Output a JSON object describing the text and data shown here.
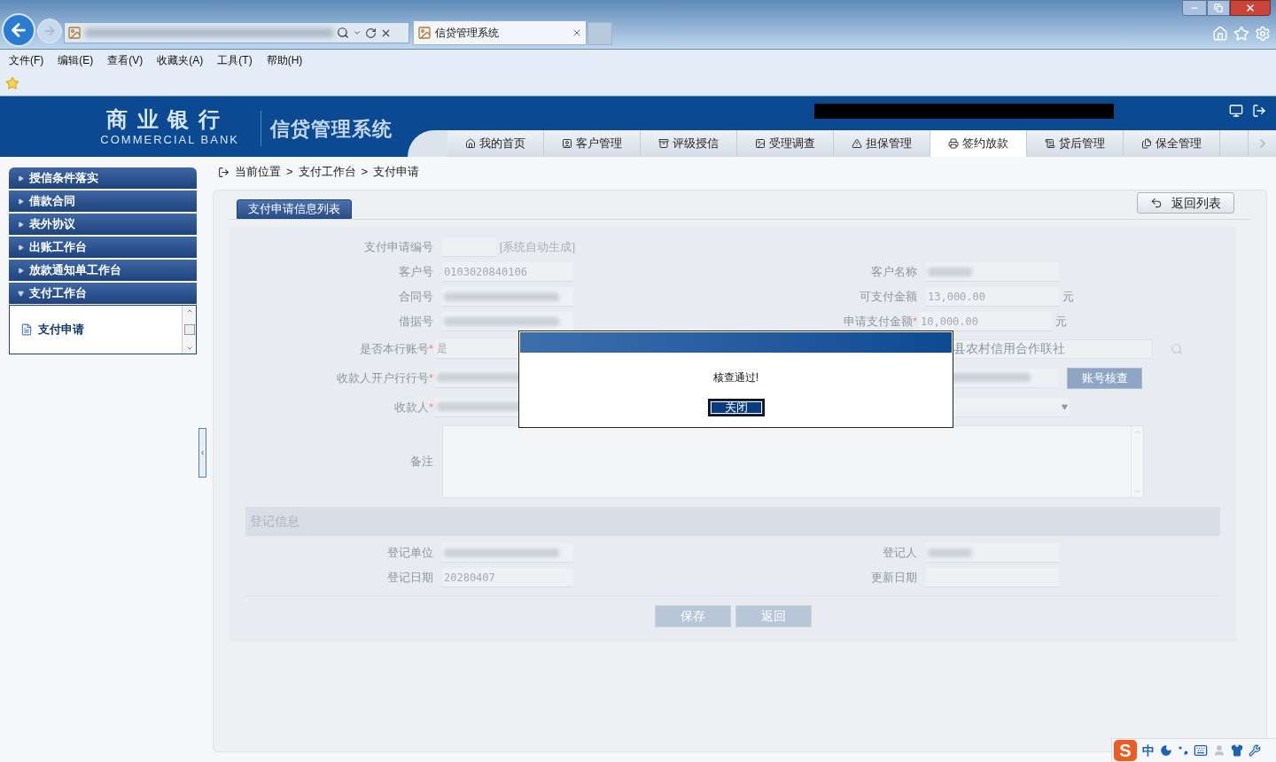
{
  "browser": {
    "tab_title": "信贷管理系统",
    "menu": [
      "文件(F)",
      "编辑(E)",
      "查看(V)",
      "收藏夹(A)",
      "工具(T)",
      "帮助(H)"
    ]
  },
  "header": {
    "logo_cn": "商 业 银 行",
    "logo_en": "COMMERCIAL BANK",
    "system_name": "信贷管理系统"
  },
  "nav": [
    {
      "label": "我的首页",
      "selected": false
    },
    {
      "label": "客户管理",
      "selected": false
    },
    {
      "label": "评级授信",
      "selected": false
    },
    {
      "label": "受理调查",
      "selected": false
    },
    {
      "label": "担保管理",
      "selected": false
    },
    {
      "label": "签约放款",
      "selected": true
    },
    {
      "label": "贷后管理",
      "selected": false
    },
    {
      "label": "保全管理",
      "selected": false
    }
  ],
  "sidebar": [
    {
      "label": "授信条件落实",
      "expanded": false
    },
    {
      "label": "借款合同",
      "expanded": false
    },
    {
      "label": "表外协议",
      "expanded": false
    },
    {
      "label": "出账工作台",
      "expanded": false
    },
    {
      "label": "放款通知单工作台",
      "expanded": false
    },
    {
      "label": "支付工作台",
      "expanded": true,
      "children": [
        {
          "label": "支付申请",
          "selected": true
        }
      ]
    }
  ],
  "breadcrumb": {
    "prefix": "当前位置",
    "separator": ">",
    "items": [
      "支付工作台",
      "支付申请"
    ]
  },
  "panel": {
    "tab": "支付申请信息列表",
    "back_button": "返回列表"
  },
  "form": {
    "required_mark": "*",
    "rows": [
      {
        "cells": [
          {
            "kind": "field",
            "label": "支付申请编号",
            "required": false,
            "note": "[系统自动生成]"
          }
        ]
      },
      {
        "cells": [
          {
            "kind": "field",
            "label": "客户号",
            "required": false,
            "value": "0103020840106"
          },
          {
            "kind": "field",
            "label": "客户名称",
            "required": false,
            "redacted": true
          }
        ]
      },
      {
        "cells": [
          {
            "kind": "field",
            "label": "合同号",
            "required": false,
            "redacted": true
          },
          {
            "kind": "field",
            "label": "可支付金额",
            "required": false,
            "value": "13,000.00",
            "unit": "元"
          }
        ]
      },
      {
        "cells": [
          {
            "kind": "field",
            "label": "借据号",
            "required": false,
            "redacted": true
          },
          {
            "kind": "field",
            "label": "申请支付金额",
            "required": true,
            "value": "10,000.00",
            "unit": "元"
          }
        ]
      },
      {
        "cells": [
          {
            "kind": "field",
            "label": "是否本行账号",
            "required": true,
            "value": "是"
          },
          {
            "kind": "lookup",
            "value": "县农村信用合作联社"
          }
        ]
      },
      {
        "cells": [
          {
            "kind": "field",
            "label": "收款人开户行行号",
            "required": true,
            "redacted": true
          },
          {
            "kind": "check",
            "redacted": true,
            "button": "账号核查"
          }
        ]
      },
      {
        "cells": [
          {
            "kind": "field",
            "label": "收款人",
            "required": true,
            "redacted": true
          },
          {
            "kind": "select"
          }
        ]
      },
      {
        "cells": [
          {
            "kind": "textarea",
            "label": "备注",
            "required": false
          }
        ]
      }
    ],
    "section_title": "登记信息",
    "reg_rows": [
      {
        "cells": [
          {
            "kind": "field",
            "label": "登记单位",
            "required": false,
            "redacted": true
          },
          {
            "kind": "field",
            "label": "登记人",
            "required": false,
            "redacted": true
          }
        ]
      },
      {
        "cells": [
          {
            "kind": "field",
            "label": "登记日期",
            "required": false,
            "value": "20280407"
          },
          {
            "kind": "field",
            "label": "更新日期",
            "required": false
          }
        ]
      }
    ],
    "buttons": [
      "保存",
      "返回"
    ]
  },
  "dialog": {
    "message": "核查通过!",
    "button": "关闭"
  },
  "ime": {
    "logo": "S",
    "mode": "中"
  }
}
